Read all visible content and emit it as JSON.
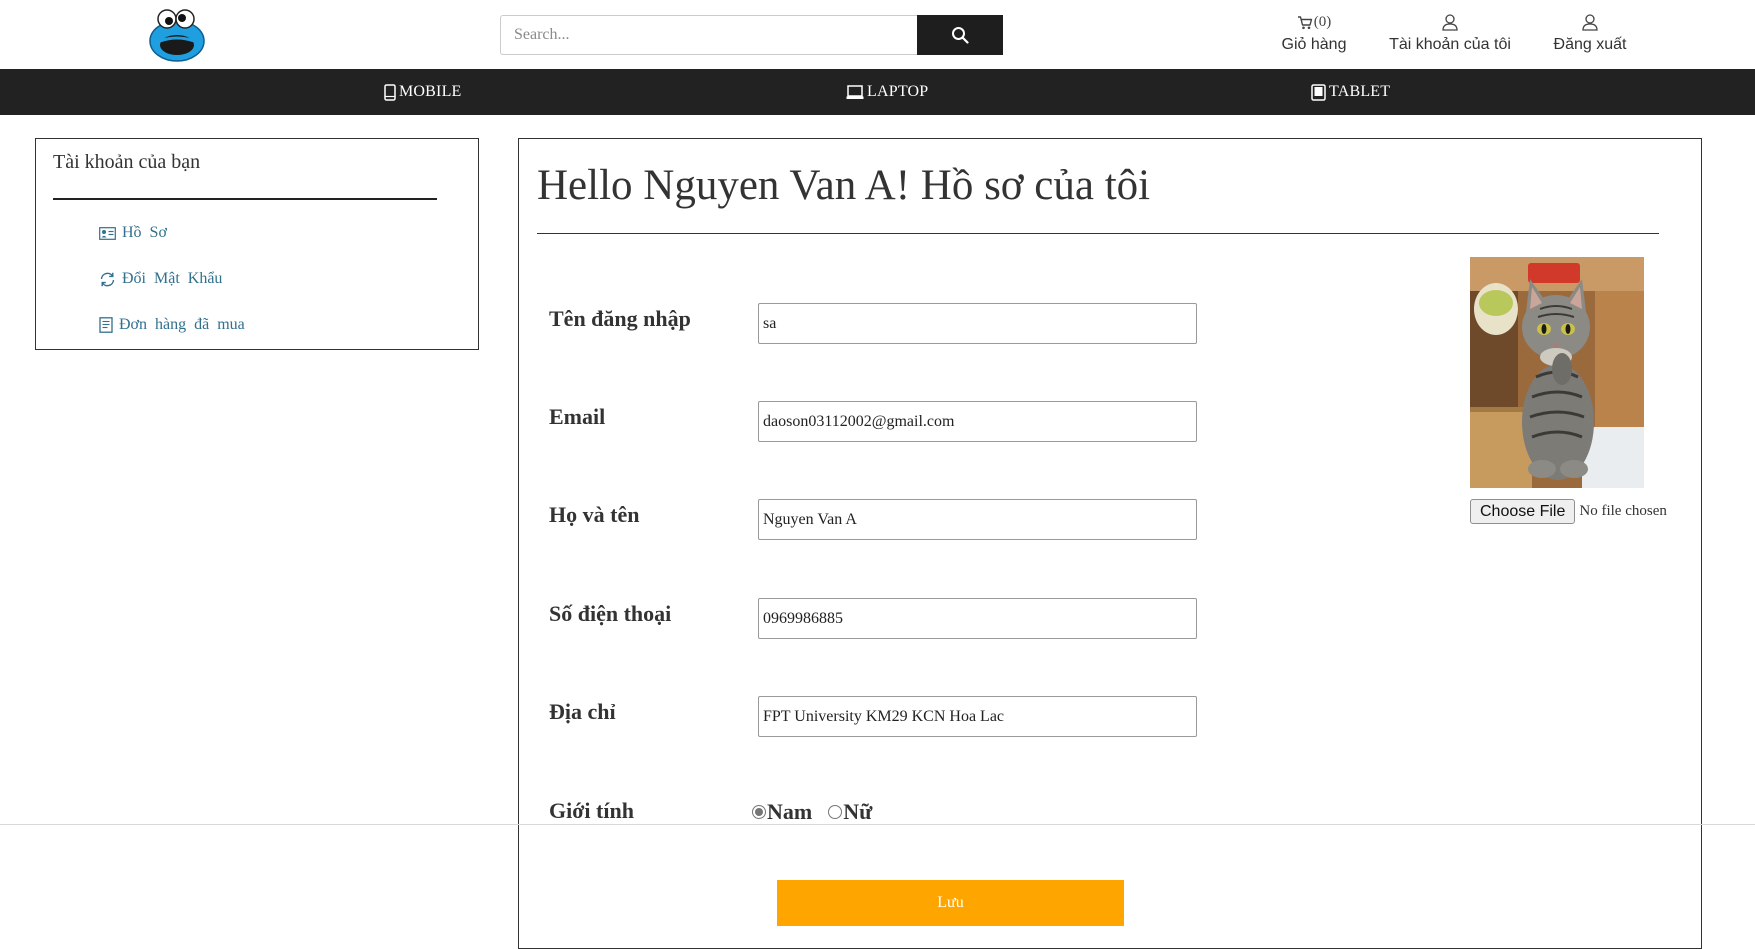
{
  "header": {
    "search": {
      "placeholder": "Search..."
    },
    "cart": {
      "count": "(0)",
      "label": "Giỏ hàng"
    },
    "account_label": "Tài khoản của tôi",
    "logout_label": "Đăng xuất"
  },
  "categories": [
    {
      "label": "MOBILE",
      "icon": "mobile-icon"
    },
    {
      "label": "LAPTOP",
      "icon": "laptop-icon"
    },
    {
      "label": "TABLET",
      "icon": "tablet-icon"
    }
  ],
  "sidebar": {
    "title": "Tài khoản của bạn",
    "items": [
      {
        "label": "Hồ Sơ",
        "icon": "id-card-icon"
      },
      {
        "label": "Đổi Mật Khẩu",
        "icon": "refresh-icon"
      },
      {
        "label": "Đơn hàng đã mua",
        "icon": "receipt-icon"
      }
    ]
  },
  "profile": {
    "title": "Hello Nguyen Van A! Hồ sơ của tôi",
    "fields": [
      {
        "label": "Tên đăng nhập",
        "value": "sa"
      },
      {
        "label": "Email",
        "value": "daoson03112002@gmail.com"
      },
      {
        "label": "Họ và tên",
        "value": "Nguyen Van A"
      },
      {
        "label": "Số điện thoại",
        "value": "0969986885"
      },
      {
        "label": "Địa chỉ",
        "value": "FPT University KM29 KCN Hoa Lac"
      }
    ],
    "gender": {
      "label": "Giới tính",
      "options": [
        "Nam",
        "Nữ"
      ],
      "selected": "Nam"
    },
    "file": {
      "button": "Choose File",
      "status": "No file chosen"
    },
    "save_label": "Lưu"
  },
  "colors": {
    "nav_bg": "#222222",
    "save_button": "#ffa500",
    "sidebar_link": "#31708f"
  }
}
